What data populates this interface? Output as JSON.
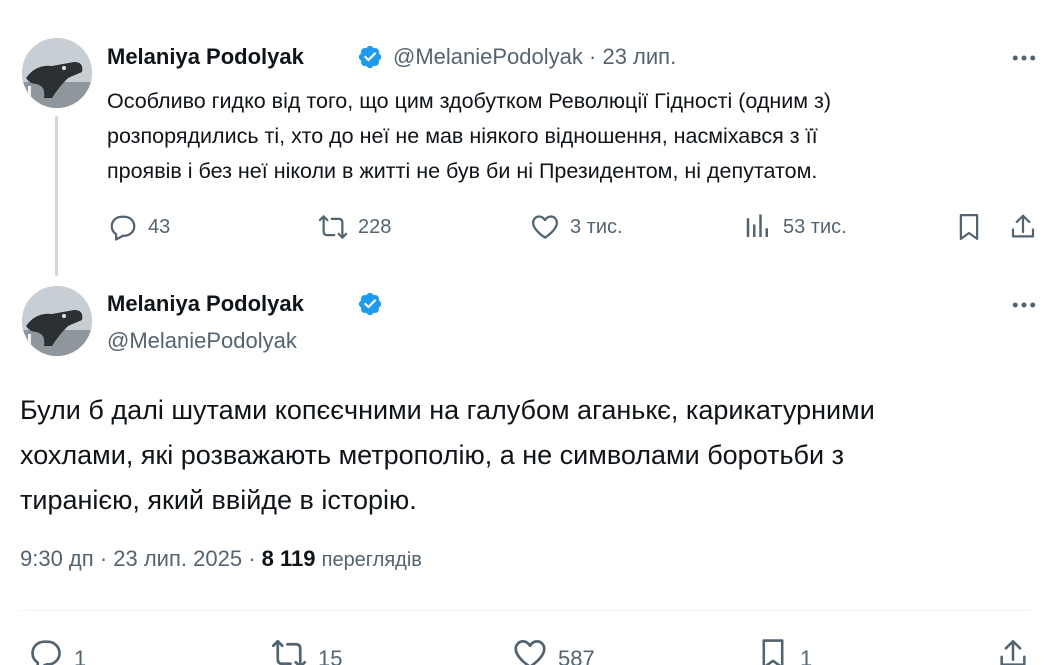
{
  "tweet1": {
    "author_name": "Melaniya Podolyak",
    "handle": "@MelaniePodolyak",
    "separator": "·",
    "date": "23 лип.",
    "text_lines": [
      "Особливо гидко від того, що цим здобутком Революції Гідності (одним з)",
      "розпорядились ті, хто до неї не мав ніякого відношення, насміхався з її",
      "проявів і без неї ніколи в житті не був би ні Президентом, ні депутатом."
    ],
    "actions": {
      "replies": "43",
      "reposts": "228",
      "likes": "3 тис.",
      "views": "53 тис."
    }
  },
  "tweet2": {
    "author_name": "Melaniya Podolyak",
    "handle": "@MelaniePodolyak",
    "text_lines": [
      "Були б далі шутами копєєчними на галубом аганькє, карикатурними",
      "хохлами, які розважають метрополію, а не символами боротьби з",
      "тиранією, який ввійде в історію."
    ],
    "time": "9:30 дп",
    "separator": "·",
    "date": "23 лип. 2025",
    "separator2": "·",
    "views_count": "8 119",
    "views_label": "переглядів",
    "actions": {
      "replies": "1",
      "reposts": "15",
      "likes": "587",
      "bookmarks": "1"
    }
  },
  "colors": {
    "text": "#0f1419",
    "secondary": "#536471",
    "verified_blue": "#1d9bf0",
    "thread_line": "#cfd9de",
    "divider": "#eff3f4"
  },
  "icons": {
    "verified": "verified-badge-icon",
    "more": "more-horizontal-icon",
    "reply": "reply-icon",
    "repost": "repost-icon",
    "like": "heart-icon",
    "views": "views-chart-icon",
    "bookmark": "bookmark-icon",
    "share": "share-icon"
  }
}
